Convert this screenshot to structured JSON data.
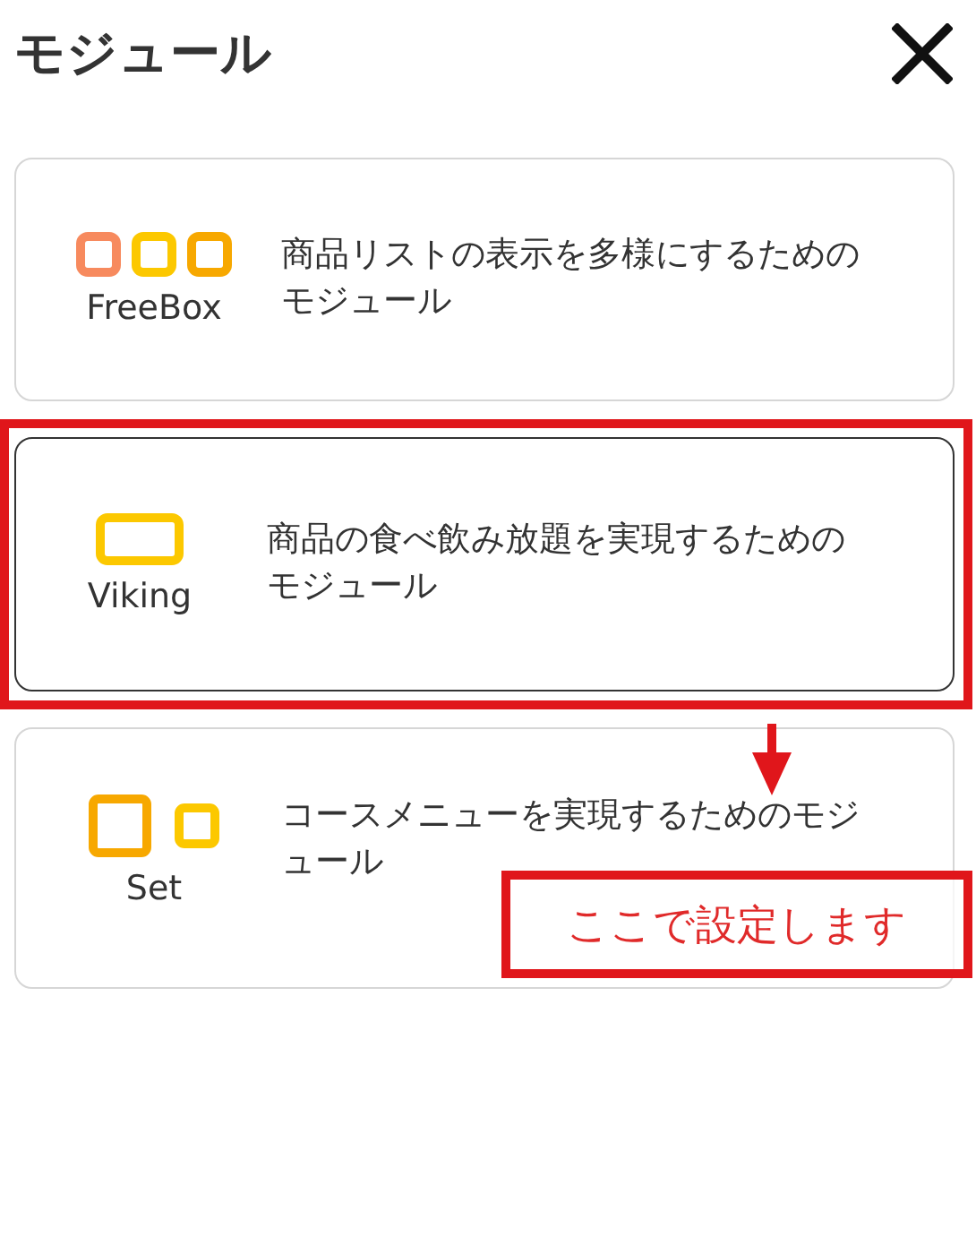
{
  "header": {
    "title": "モジュール"
  },
  "modules": [
    {
      "kind": "freebox",
      "name": "FreeBox",
      "description": "商品リストの表示を多様にするためのモジュール",
      "selected": false
    },
    {
      "kind": "viking",
      "name": "Viking",
      "description": "商品の食べ飲み放題を実現するためのモジュール",
      "selected": true
    },
    {
      "kind": "set",
      "name": "Set",
      "description": "コースメニューを実現するためのモジュール",
      "selected": false
    }
  ],
  "annotation": {
    "text": "ここで設定します"
  }
}
